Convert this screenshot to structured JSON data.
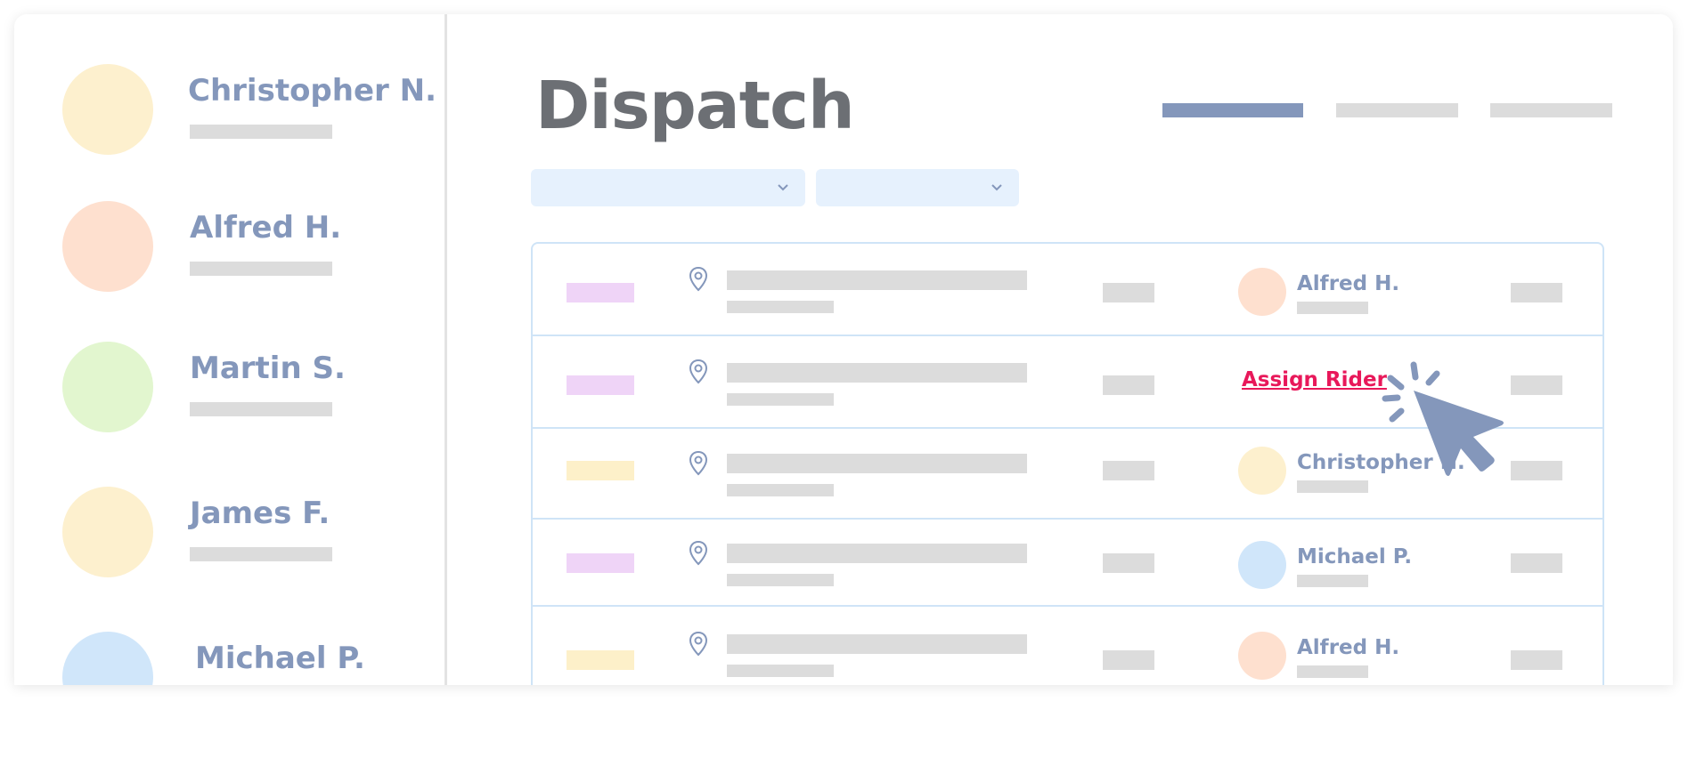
{
  "app": {
    "title": "Dispatch"
  },
  "colors": {
    "accent": "#8497bb",
    "link": "#e8185a",
    "placeholder": "#dcdcdc",
    "avatar_yellow": "#fdf0ce",
    "avatar_orange": "#fee0cf",
    "avatar_green": "#e2f6cf",
    "avatar_blue": "#d0e6fa",
    "tag_purple": "#efd4f7",
    "tag_yellow": "#fdf0c9"
  },
  "sidebar": {
    "riders": [
      {
        "name": "Christopher N.",
        "avatar_color": "#fdf0ce"
      },
      {
        "name": "Alfred H.",
        "avatar_color": "#fee0cf"
      },
      {
        "name": "Martin S.",
        "avatar_color": "#e2f6cf"
      },
      {
        "name": "James F.",
        "avatar_color": "#fdf0ce"
      },
      {
        "name": "Michael P.",
        "avatar_color": "#d0e6fa"
      }
    ]
  },
  "tabs": {
    "active_index": 0,
    "count": 3
  },
  "filters": {
    "icon": "chevron-down-icon",
    "count": 2
  },
  "orders": {
    "location_icon": "map-pin-icon",
    "rows": [
      {
        "tag_color": "#efd4f7",
        "rider": "Alfred H.",
        "rider_color": "#fee0cf"
      },
      {
        "tag_color": "#efd4f7",
        "action": "Assign Rider"
      },
      {
        "tag_color": "#fdf0c9",
        "rider": "Christopher N.",
        "rider_color": "#fdf0ce"
      },
      {
        "tag_color": "#efd4f7",
        "rider": "Michael P.",
        "rider_color": "#d0e6fa"
      },
      {
        "tag_color": "#fdf0c9",
        "rider": "Alfred H.",
        "rider_color": "#fee0cf"
      }
    ]
  },
  "cursor": {
    "icon": "click-cursor-icon"
  }
}
